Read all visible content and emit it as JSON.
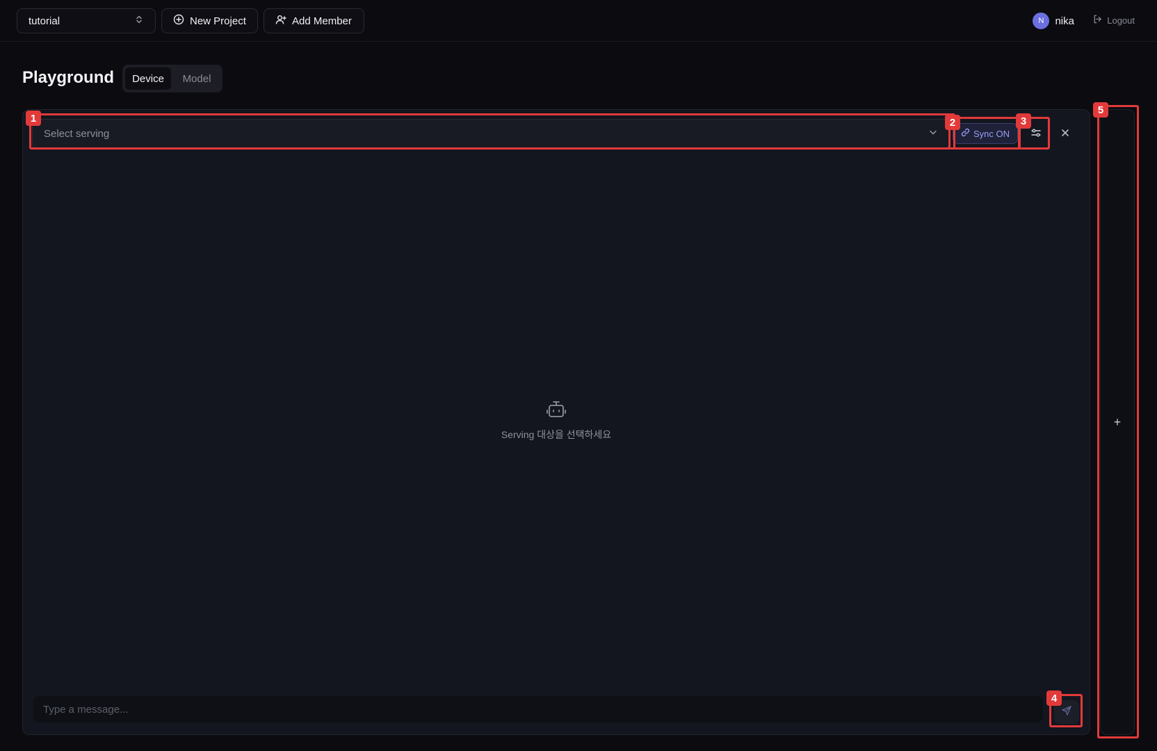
{
  "topbar": {
    "project_select": {
      "value": "tutorial"
    },
    "new_project_label": "New Project",
    "add_member_label": "Add Member",
    "user": {
      "initial": "N",
      "name": "nika"
    },
    "logout_label": "Logout"
  },
  "header": {
    "title": "Playground",
    "tabs": [
      {
        "label": "Device",
        "active": true
      },
      {
        "label": "Model",
        "active": false
      }
    ]
  },
  "panel": {
    "serving_select": {
      "placeholder": "Select serving"
    },
    "sync_label": "Sync ON",
    "empty_state": "Serving 대상을 선택하세요",
    "message_input": {
      "placeholder": "Type a message..."
    }
  },
  "add_panel_label": "+",
  "annotations": [
    {
      "number": "1",
      "target": "serving-select"
    },
    {
      "number": "2",
      "target": "sync-button"
    },
    {
      "number": "3",
      "target": "settings-button"
    },
    {
      "number": "4",
      "target": "send-button"
    },
    {
      "number": "5",
      "target": "add-panel-column"
    }
  ],
  "colors": {
    "background": "#0b0b10",
    "panel": "#14161f",
    "accent": "#9aa0f5",
    "annotation": "#e23a3a",
    "avatar": "#6b6fe0"
  }
}
